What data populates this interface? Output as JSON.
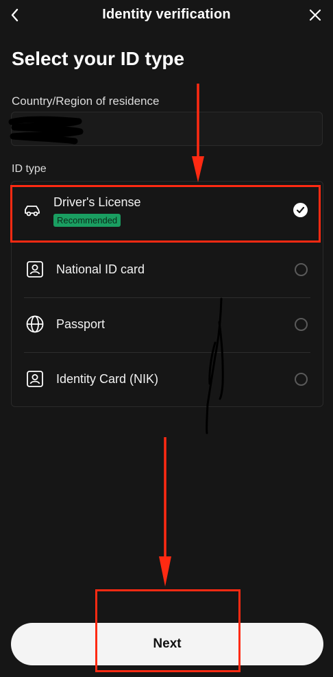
{
  "header": {
    "title": "Identity verification",
    "back_icon": "chevron-left-icon",
    "close_icon": "close-icon"
  },
  "page_title": "Select your ID type",
  "country": {
    "label": "Country/Region of residence",
    "value_redacted": true
  },
  "id_type": {
    "label": "ID type",
    "options": [
      {
        "label": "Driver's License",
        "icon": "car-icon",
        "badge": "Recommended",
        "selected": true
      },
      {
        "label": "National ID card",
        "icon": "id-card-icon",
        "selected": false
      },
      {
        "label": "Passport",
        "icon": "globe-icon",
        "selected": false
      },
      {
        "label": "Identity Card (NIK)",
        "icon": "id-card-icon",
        "selected": false
      }
    ]
  },
  "next_button": {
    "label": "Next"
  },
  "colors": {
    "background": "#161616",
    "badge": "#1a9e61",
    "annotation": "#ff2a12",
    "button": "#f4f4f4"
  }
}
